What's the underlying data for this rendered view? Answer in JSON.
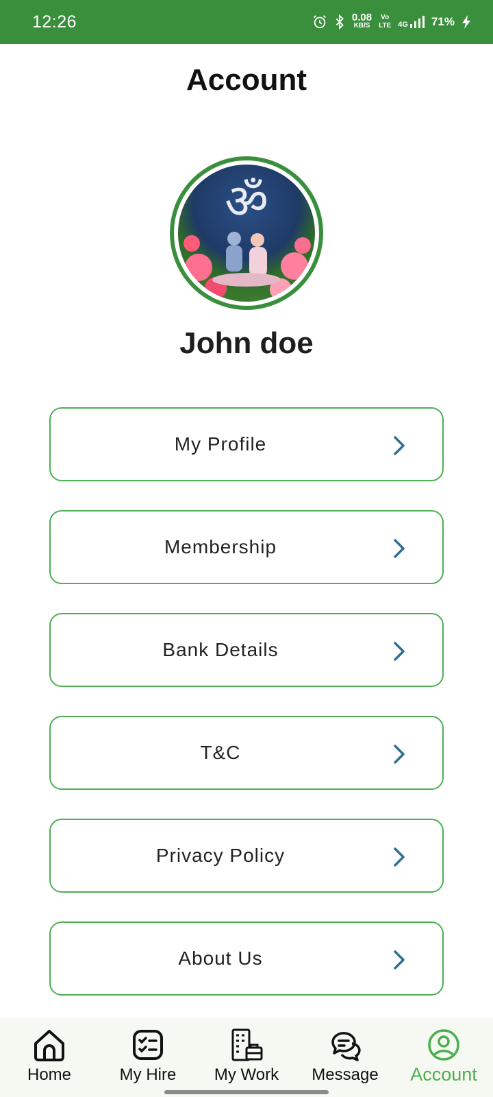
{
  "status_bar": {
    "time": "12:26",
    "net_speed_value": "0.08",
    "net_speed_unit": "KB/S",
    "volte_top": "Vo",
    "volte_bottom": "LTE",
    "network": "4G",
    "battery": "71%",
    "background_color": "#3a8f3c"
  },
  "header": {
    "title": "Account"
  },
  "profile": {
    "name": "John doe",
    "border_color": "#3a8f3c"
  },
  "menu": {
    "items": [
      {
        "label": "My Profile"
      },
      {
        "label": "Membership"
      },
      {
        "label": "Bank Details"
      },
      {
        "label": "T&C"
      },
      {
        "label": "Privacy Policy"
      },
      {
        "label": "About Us"
      }
    ],
    "border_color": "#4caf50",
    "chevron_color": "#2f6f8f"
  },
  "bottom_nav": {
    "items": [
      {
        "label": "Home",
        "icon": "home-icon"
      },
      {
        "label": "My Hire",
        "icon": "checklist-icon"
      },
      {
        "label": "My Work",
        "icon": "building-briefcase-icon"
      },
      {
        "label": "Message",
        "icon": "chat-bubbles-icon"
      },
      {
        "label": "Account",
        "icon": "user-circle-icon",
        "active": true
      }
    ],
    "active_color": "#4caf50"
  }
}
